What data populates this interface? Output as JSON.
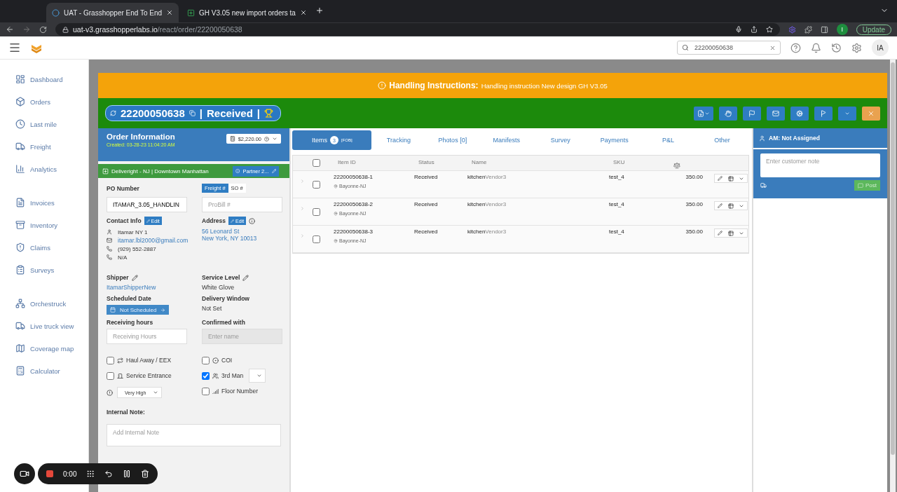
{
  "browser": {
    "tabs": [
      {
        "title": "UAT - Grasshopper End To End",
        "selected": true,
        "kind": "site"
      },
      {
        "title": "GH V3.05 new import orders ta",
        "selected": false,
        "kind": "sheet"
      }
    ],
    "url_host": "uat-v3.grasshopperlabs.io",
    "url_path": "/react/order/22200050638",
    "update": "Update",
    "profile": "I"
  },
  "header": {
    "search_value": "22200050638",
    "avatar": "IA"
  },
  "sidebar": {
    "groups": [
      [
        {
          "label": "Dashboard",
          "kind": "dashboard"
        },
        {
          "label": "Orders",
          "kind": "orders"
        },
        {
          "label": "Last mile",
          "kind": "clock"
        },
        {
          "label": "Freight",
          "kind": "freight"
        },
        {
          "label": "Analytics",
          "kind": "analytics"
        }
      ],
      [
        {
          "label": "Invoices",
          "kind": "invoice"
        },
        {
          "label": "Inventory",
          "kind": "inventory"
        },
        {
          "label": "Claims",
          "kind": "claims"
        },
        {
          "label": "Surveys",
          "kind": "survey"
        }
      ],
      [
        {
          "label": "Orchestruck",
          "kind": "orchestruck"
        },
        {
          "label": "Live truck view",
          "kind": "truck"
        },
        {
          "label": "Coverage map",
          "kind": "map"
        },
        {
          "label": "Calculator",
          "kind": "calculator"
        }
      ]
    ]
  },
  "banner": {
    "label": "Handling Instructions:",
    "text": "Handling instruction New design GH V3.05"
  },
  "order": {
    "number": "22200050638",
    "separator": "|",
    "status": "Received",
    "end": "|"
  },
  "order_info": {
    "title": "Order Information",
    "created": "Created: 03-28-23 11:04:20 AM",
    "amount": "$2,220.00",
    "partner_line": "Deliveright - NJ | Downtown Manhattan",
    "partner_button": "Partner 2...",
    "po_label": "PO Number",
    "po_value": "ITAMAR_3.05_HANDLIN",
    "ref_tabs": [
      {
        "label": "Freight #",
        "selected": true
      },
      {
        "label": "SO #",
        "selected": false
      }
    ],
    "probill_placeholder": "ProBill #",
    "contact_label": "Contact Info",
    "edit": "Edit",
    "contact": [
      {
        "kind": "person",
        "text": "Itamar NY 1"
      },
      {
        "kind": "email",
        "text": "itamar.lbl2000@gmail.com"
      },
      {
        "kind": "phone",
        "text": "(929) 552-2887"
      },
      {
        "kind": "phone",
        "text": "N/A"
      }
    ],
    "address_label": "Address",
    "address_edit": "Edit",
    "address": [
      "56 Leonard St",
      "New York, NY 10013"
    ],
    "shipper_label": "Shipper",
    "shipper": "ItamarShipperNew",
    "service_label": "Service Level",
    "service": "White Glove",
    "scheduled_label": "Scheduled Date",
    "scheduled": "Not Scheduled",
    "window_label": "Delivery Window",
    "window": "Not Set",
    "receiving_label": "Receiving hours",
    "receiving_placeholder": "Receiving Hours",
    "confirmed_label": "Confirmed with",
    "confirmed_placeholder": "Enter name",
    "options_left": [
      {
        "kind": "haul",
        "label": "Haul Away / EEX",
        "checked": false
      },
      {
        "kind": "door",
        "label": "Service Entrance",
        "checked": false
      }
    ],
    "options_right": [
      {
        "kind": "coi",
        "label": "COI",
        "checked": false
      },
      {
        "kind": "people",
        "label": "3rd Man",
        "checked": true
      },
      {
        "kind": "signal",
        "label": "Floor Number",
        "checked": false
      }
    ],
    "priority": "Very High",
    "note_label": "Internal Note:",
    "note_placeholder": "Add Internal Note"
  },
  "tabs": [
    {
      "label": "Items",
      "count": "3",
      "tag": "[FOB]",
      "selected": true
    },
    {
      "label": "Tracking",
      "selected": false
    },
    {
      "label": "Photos [0]",
      "selected": false
    },
    {
      "label": "Manifests",
      "selected": false
    },
    {
      "label": "Survey",
      "selected": false
    },
    {
      "label": "Payments",
      "selected": false
    },
    {
      "label": "P&L",
      "selected": false
    },
    {
      "label": "Other",
      "selected": false
    }
  ],
  "table": {
    "all_checked": false,
    "columns": [
      "Item ID",
      "Status",
      "Name",
      "SKU"
    ],
    "rows": [
      {
        "id": "22200050638-1",
        "location": "Bayonne-NJ",
        "status": "Received",
        "name_a": "kitchen",
        "name_b": "Vendor3",
        "sku": "test_4",
        "weight": "350.00",
        "checked": false
      },
      {
        "id": "22200050638-2",
        "location": "Bayonne-NJ",
        "status": "Received",
        "name_a": "kitchen",
        "name_b": "Vendor3",
        "sku": "test_4",
        "weight": "350.00",
        "checked": false
      },
      {
        "id": "22200050638-3",
        "location": "Bayonne-NJ",
        "status": "Received",
        "name_a": "kitchen",
        "name_b": "Vendor3",
        "sku": "test_4",
        "weight": "350.00",
        "checked": false
      }
    ]
  },
  "side": {
    "title": "AM: Not Assigned",
    "placeholder": "Enter customer note",
    "post": "Post"
  },
  "recorder": {
    "time": "0:00"
  }
}
